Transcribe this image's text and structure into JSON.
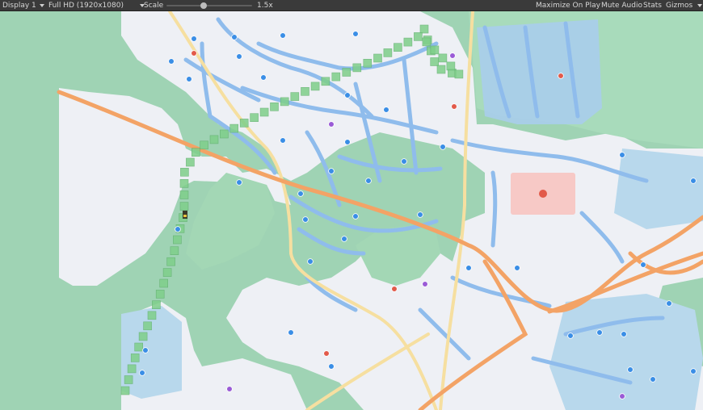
{
  "toolbar": {
    "display": "Display 1",
    "resolution": "Full HD (1920x1080)",
    "scale_label": "Scale",
    "scale_value": "1.5x",
    "scale_fraction": 0.3,
    "maximize": "Maximize On Play",
    "mute": "Mute Audio",
    "stats": "Stats",
    "gizmos": "Gizmos"
  },
  "colors": {
    "toolbar_bg": "#3a3a3a",
    "map_green": "#9fd3b4",
    "map_land": "#eef0f5",
    "water": "#9cc6ee",
    "highway": "#f3a366",
    "minor_road": "#f6dfa0",
    "path_tile": "#7fcf8a",
    "poi_blue": "#3a8ee6",
    "poi_red": "#e25a4a",
    "poi_purple": "#9a5bd6"
  },
  "path_tiles": 56
}
